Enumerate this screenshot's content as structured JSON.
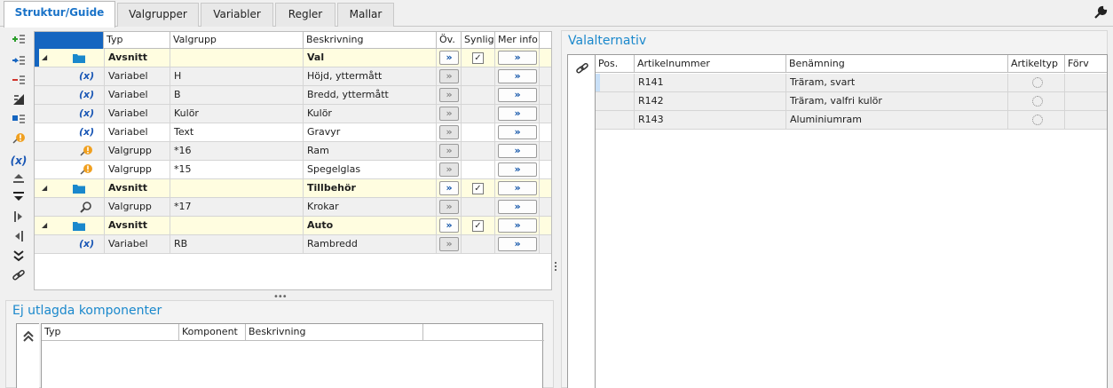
{
  "tabs": [
    {
      "label": "Struktur/Guide",
      "active": true
    },
    {
      "label": "Valgrupper",
      "active": false
    },
    {
      "label": "Variabler",
      "active": false
    },
    {
      "label": "Regler",
      "active": false
    },
    {
      "label": "Mallar",
      "active": false
    }
  ],
  "toolbar": {
    "buttons": [
      "add-row-icon",
      "insert-row-icon",
      "remove-row-icon",
      "clear-icon",
      "move-section-icon",
      "rule-warning-icon",
      "variable-icon",
      "move-up-icon",
      "move-down-icon",
      "indent-icon",
      "outdent-icon",
      "expand-all-icon",
      "link-icon"
    ]
  },
  "main_grid": {
    "headers": [
      "",
      "Typ",
      "Valgrupp",
      "Beskrivning",
      "Öv.",
      "Synlig",
      "Mer info"
    ],
    "rows": [
      {
        "kind": "section",
        "typ": "Avsnitt",
        "valgrupp": "",
        "beskrivning": "Val",
        "synlig": true,
        "ov_active": true
      },
      {
        "kind": "variable",
        "typ": "Variabel",
        "valgrupp": "H",
        "beskrivning": "Höjd, yttermått",
        "ov_active": false
      },
      {
        "kind": "variable",
        "typ": "Variabel",
        "valgrupp": "B",
        "beskrivning": "Bredd, yttermått",
        "ov_active": false
      },
      {
        "kind": "variable",
        "typ": "Variabel",
        "valgrupp": "Kulör",
        "beskrivning": "Kulör",
        "ov_active": false
      },
      {
        "kind": "variable",
        "typ": "Variabel",
        "valgrupp": "Text",
        "beskrivning": "Gravyr",
        "ov_active": false
      },
      {
        "kind": "group",
        "typ": "Valgrupp",
        "valgrupp": "*16",
        "beskrivning": "Ram",
        "ov_active": false
      },
      {
        "kind": "group",
        "typ": "Valgrupp",
        "valgrupp": "*15",
        "beskrivning": "Spegelglas",
        "ov_active": false
      },
      {
        "kind": "section",
        "typ": "Avsnitt",
        "valgrupp": "",
        "beskrivning": "Tillbehör",
        "synlig": true,
        "ov_active": true
      },
      {
        "kind": "group-search",
        "typ": "Valgrupp",
        "valgrupp": "*17",
        "beskrivning": "Krokar",
        "ov_active": false
      },
      {
        "kind": "section",
        "typ": "Avsnitt",
        "valgrupp": "",
        "beskrivning": "Auto",
        "synlig": true,
        "ov_active": true
      },
      {
        "kind": "variable",
        "typ": "Variabel",
        "valgrupp": "RB",
        "beskrivning": "Rambredd",
        "ov_active": false
      }
    ],
    "arrow_glyph": "»"
  },
  "bottom_panel": {
    "title": "Ej utlagda komponenter",
    "headers": [
      "Typ",
      "Komponent",
      "Beskrivning",
      ""
    ]
  },
  "right_panel": {
    "title": "Valalternativ",
    "headers": [
      "Pos.",
      "Artikelnummer",
      "Benämning",
      "Artikeltyp",
      "Förv"
    ],
    "rows": [
      {
        "artikelnummer": "R141",
        "benamning": "Träram, svart"
      },
      {
        "artikelnummer": "R142",
        "benamning": "Träram, valfri kulör"
      },
      {
        "artikelnummer": "R143",
        "benamning": "Aluminiumram"
      }
    ]
  },
  "colors": {
    "accent": "#1a88cc",
    "section_bg": "#fffde0",
    "selection": "#1565c0"
  }
}
